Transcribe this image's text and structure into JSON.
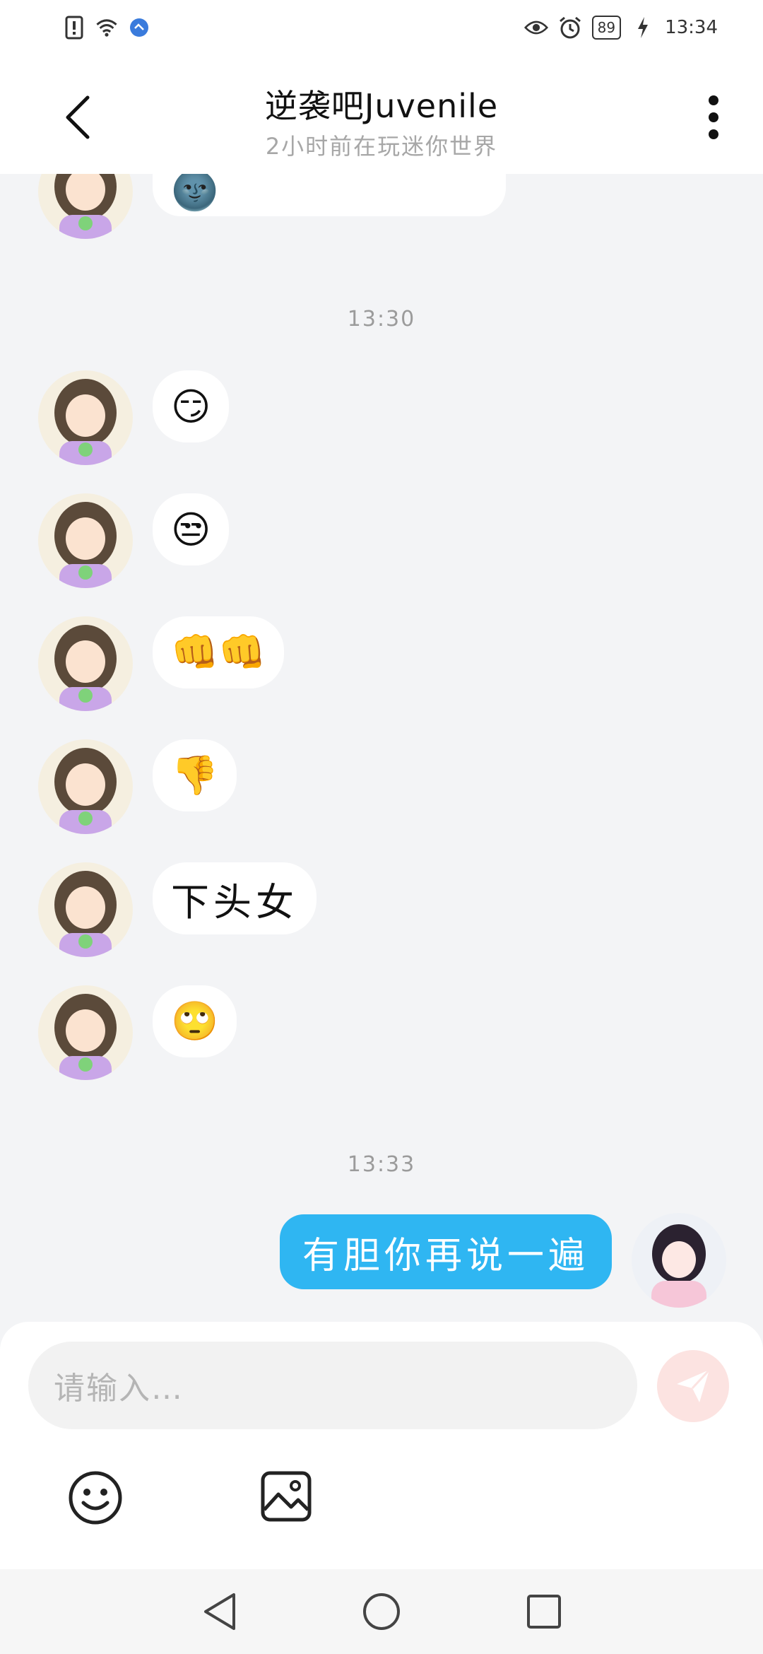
{
  "status_bar": {
    "battery": "89",
    "time": "13:34",
    "icons": [
      "alert-icon",
      "wifi-icon",
      "app-notification-icon",
      "eye-icon",
      "alarm-icon",
      "battery-icon",
      "charging-icon"
    ]
  },
  "header": {
    "title": "逆袭吧Juvenile",
    "subtitle": "2小时前在玩迷你世界"
  },
  "chat": {
    "top_partial_message": "🌚",
    "timestamps": [
      "13:30",
      "13:33"
    ],
    "incoming": [
      {
        "content": "😏"
      },
      {
        "content": "😒"
      },
      {
        "content": "👊👊"
      },
      {
        "content": "👎"
      },
      {
        "content": "下头女"
      },
      {
        "content": "🙄"
      }
    ],
    "outgoing": [
      {
        "content": "有胆你再说一遍"
      }
    ]
  },
  "input_bar": {
    "placeholder": "请输入…"
  },
  "colors": {
    "outgoing_bubble": "#2fb6f2",
    "send_button": "#fce3e1",
    "background": "#f3f4f6"
  }
}
